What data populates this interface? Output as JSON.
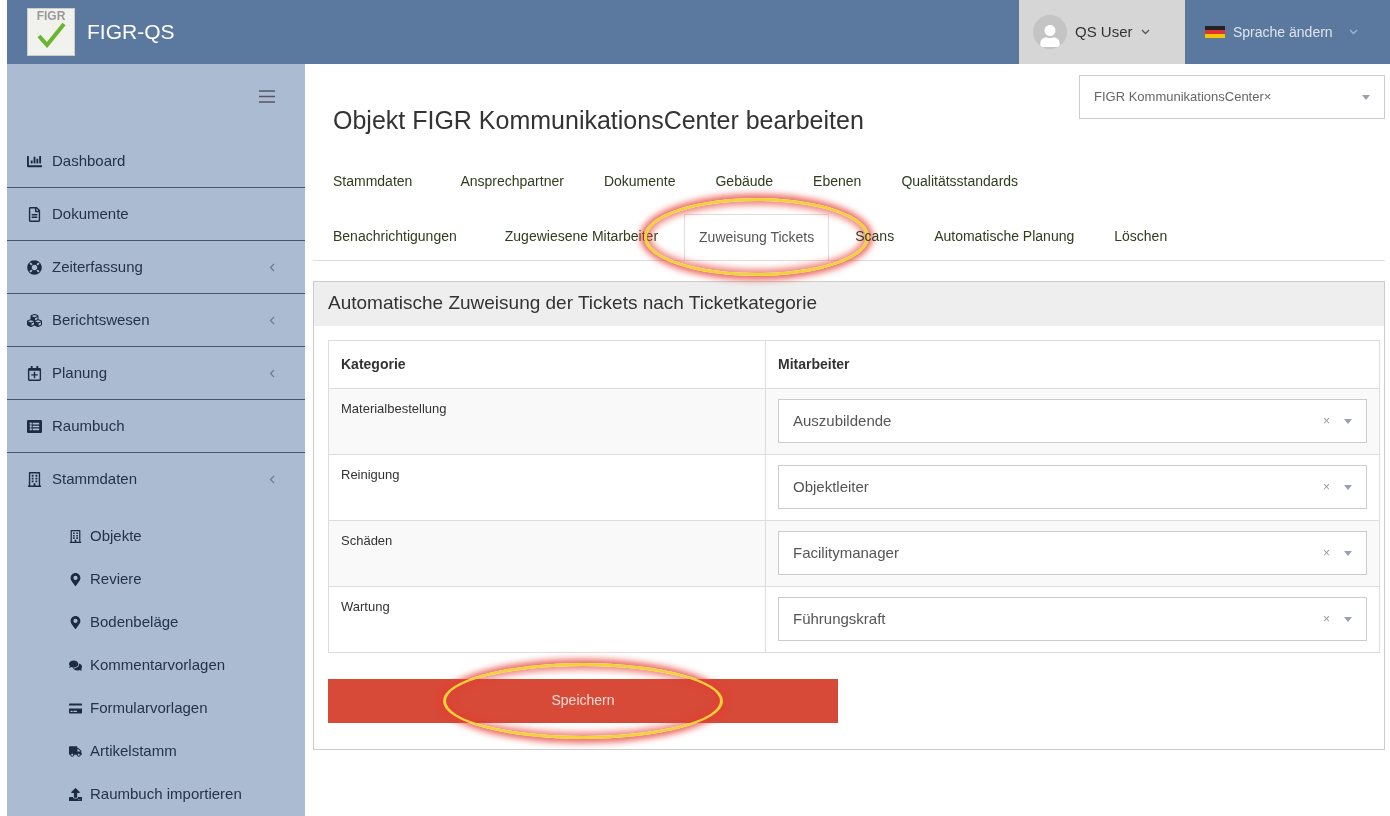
{
  "header": {
    "logo_text": "FIGR",
    "app_name": "FIGR-QS",
    "user": "QS User",
    "language": "Sprache ändern"
  },
  "sidebar": {
    "items": [
      {
        "label": "Dashboard",
        "has_submenu": false
      },
      {
        "label": "Dokumente",
        "has_submenu": false
      },
      {
        "label": "Zeiterfassung",
        "has_submenu": true
      },
      {
        "label": "Berichtswesen",
        "has_submenu": true
      },
      {
        "label": "Planung",
        "has_submenu": true
      },
      {
        "label": "Raumbuch",
        "has_submenu": false
      },
      {
        "label": "Stammdaten",
        "has_submenu": true,
        "children": [
          {
            "label": "Objekte"
          },
          {
            "label": "Reviere"
          },
          {
            "label": "Bodenbeläge"
          },
          {
            "label": "Kommentarvorlagen"
          },
          {
            "label": "Formularvorlagen"
          },
          {
            "label": "Artikelstamm"
          },
          {
            "label": "Raumbuch importieren"
          }
        ]
      }
    ]
  },
  "page": {
    "title": "Objekt FIGR KommunikationsCenter bearbeiten",
    "object_select": {
      "value": "FIGR KommunikationsCenter",
      "clear": "×"
    }
  },
  "tabs": [
    [
      {
        "label": "Stammdaten",
        "selected": false,
        "highlighted": false
      },
      {
        "label": "Ansprechpartner",
        "selected": false,
        "highlighted": false
      },
      {
        "label": "Dokumente",
        "selected": false,
        "highlighted": false
      },
      {
        "label": "Gebäude",
        "selected": false,
        "highlighted": false
      },
      {
        "label": "Ebenen",
        "selected": false,
        "highlighted": false
      },
      {
        "label": "Qualitätsstandards",
        "selected": false,
        "highlighted": false
      }
    ],
    [
      {
        "label": "Benachrichtigungen",
        "selected": false,
        "highlighted": false
      },
      {
        "label": "Zugewiesene Mitarbeiter",
        "selected": false,
        "highlighted": false
      },
      {
        "label": "Zuweisung Tickets",
        "selected": true,
        "highlighted": true
      },
      {
        "label": "Scans",
        "selected": false,
        "highlighted": false
      },
      {
        "label": "Automatische Planung",
        "selected": false,
        "highlighted": false
      },
      {
        "label": "Löschen",
        "selected": false,
        "highlighted": false
      }
    ]
  ],
  "panel": {
    "title": "Automatische Zuweisung der Tickets nach Ticketkategorie",
    "table": {
      "columns": [
        "Kategorie",
        "Mitarbeiter"
      ],
      "rows": [
        {
          "category": "Materialbestellung",
          "employee": "Auszubildende",
          "clear": "×"
        },
        {
          "category": "Reinigung",
          "employee": "Objektleiter",
          "clear": "×"
        },
        {
          "category": "Schäden",
          "employee": "Facilitymanager",
          "clear": "×"
        },
        {
          "category": "Wartung",
          "employee": "Führungskraft",
          "clear": "×"
        }
      ]
    },
    "save_button": {
      "label": "Speichern",
      "highlighted": true
    }
  }
}
